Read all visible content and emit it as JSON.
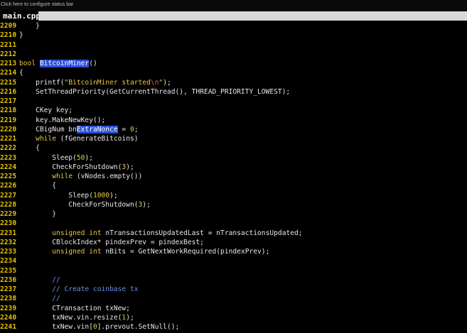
{
  "statusbar": {
    "text": "Click here to configure status bar"
  },
  "tab": {
    "label": "main.cpp"
  },
  "lines": [
    {
      "n": "2209",
      "parts": [
        {
          "t": "    }"
        }
      ]
    },
    {
      "n": "2210",
      "parts": [
        {
          "t": "}"
        }
      ]
    },
    {
      "n": "2211",
      "parts": []
    },
    {
      "n": "2212",
      "parts": []
    },
    {
      "n": "2213",
      "parts": [
        {
          "t": "bool",
          "c": "kw"
        },
        {
          "t": " "
        },
        {
          "t": "BitcoinMiner",
          "c": "hl"
        },
        {
          "t": "()"
        }
      ]
    },
    {
      "n": "2214",
      "parts": [
        {
          "t": "{"
        }
      ]
    },
    {
      "n": "2215",
      "parts": [
        {
          "t": "    printf("
        },
        {
          "t": "\"BitcoinMiner started",
          "c": "str"
        },
        {
          "t": "\\n",
          "c": "esc"
        },
        {
          "t": "\"",
          "c": "str"
        },
        {
          "t": ");"
        }
      ]
    },
    {
      "n": "2216",
      "parts": [
        {
          "t": "    SetThreadPriority(GetCurrentThread(), THREAD_PRIORITY_LOWEST);"
        }
      ]
    },
    {
      "n": "2217",
      "parts": []
    },
    {
      "n": "2218",
      "parts": [
        {
          "t": "    CKey key;"
        }
      ]
    },
    {
      "n": "2219",
      "parts": [
        {
          "t": "    key.MakeNewKey();"
        }
      ]
    },
    {
      "n": "2220",
      "parts": [
        {
          "t": "    CBigNum bn"
        },
        {
          "t": "ExtraNonce",
          "c": "hl"
        },
        {
          "t": " = "
        },
        {
          "t": "0",
          "c": "num"
        },
        {
          "t": ";"
        }
      ]
    },
    {
      "n": "2221",
      "parts": [
        {
          "t": "    "
        },
        {
          "t": "while",
          "c": "kw"
        },
        {
          "t": " (fGenerateBitcoins)"
        }
      ]
    },
    {
      "n": "2222",
      "parts": [
        {
          "t": "    {"
        }
      ]
    },
    {
      "n": "2223",
      "parts": [
        {
          "t": "        Sleep("
        },
        {
          "t": "50",
          "c": "num"
        },
        {
          "t": ");"
        }
      ]
    },
    {
      "n": "2224",
      "parts": [
        {
          "t": "        CheckForShutdown("
        },
        {
          "t": "3",
          "c": "num"
        },
        {
          "t": ");"
        }
      ]
    },
    {
      "n": "2225",
      "parts": [
        {
          "t": "        "
        },
        {
          "t": "while",
          "c": "kw"
        },
        {
          "t": " (vNodes.empty())"
        }
      ]
    },
    {
      "n": "2226",
      "parts": [
        {
          "t": "        {"
        }
      ]
    },
    {
      "n": "2227",
      "parts": [
        {
          "t": "            Sleep("
        },
        {
          "t": "1000",
          "c": "num"
        },
        {
          "t": ");"
        }
      ]
    },
    {
      "n": "2228",
      "parts": [
        {
          "t": "            CheckForShutdown("
        },
        {
          "t": "3",
          "c": "num"
        },
        {
          "t": ");"
        }
      ]
    },
    {
      "n": "2229",
      "parts": [
        {
          "t": "        }"
        }
      ]
    },
    {
      "n": "2230",
      "parts": []
    },
    {
      "n": "2231",
      "parts": [
        {
          "t": "        "
        },
        {
          "t": "unsigned",
          "c": "typ"
        },
        {
          "t": " "
        },
        {
          "t": "int",
          "c": "typ"
        },
        {
          "t": " nTransactionsUpdatedLast = nTransactionsUpdated;"
        }
      ]
    },
    {
      "n": "2232",
      "parts": [
        {
          "t": "        CBlockIndex* pindexPrev = pindexBest;"
        }
      ]
    },
    {
      "n": "2233",
      "parts": [
        {
          "t": "        "
        },
        {
          "t": "unsigned",
          "c": "typ"
        },
        {
          "t": " "
        },
        {
          "t": "int",
          "c": "typ"
        },
        {
          "t": " nBits = GetNextWorkRequired(pindexPrev);"
        }
      ]
    },
    {
      "n": "2234",
      "parts": []
    },
    {
      "n": "2235",
      "parts": []
    },
    {
      "n": "2236",
      "parts": [
        {
          "t": "        "
        },
        {
          "t": "//",
          "c": "cmt"
        }
      ]
    },
    {
      "n": "2237",
      "parts": [
        {
          "t": "        "
        },
        {
          "t": "// Create coinbase tx",
          "c": "cmt"
        }
      ]
    },
    {
      "n": "2238",
      "parts": [
        {
          "t": "        "
        },
        {
          "t": "//",
          "c": "cmt"
        }
      ]
    },
    {
      "n": "2239",
      "parts": [
        {
          "t": "        CTransaction txNew;"
        }
      ]
    },
    {
      "n": "2240",
      "parts": [
        {
          "t": "        txNew.vin.resize("
        },
        {
          "t": "1",
          "c": "num"
        },
        {
          "t": ");"
        }
      ]
    },
    {
      "n": "2241",
      "parts": [
        {
          "t": "        txNew.vin["
        },
        {
          "t": "0",
          "c": "num"
        },
        {
          "t": "].prevout.SetNull();"
        }
      ]
    }
  ]
}
